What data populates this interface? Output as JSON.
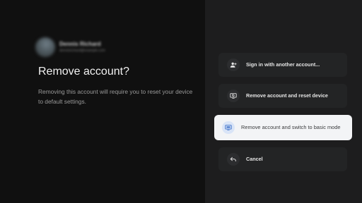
{
  "account": {
    "name": "Dennis Richard",
    "email": "dennisrichard@example.com"
  },
  "dialog": {
    "title": "Remove account?",
    "description": "Removing this account will require you to reset your device to default settings."
  },
  "options": [
    {
      "label": "Sign in with another account...",
      "icon": "person-add-icon",
      "focused": false
    },
    {
      "label": "Remove account and reset device",
      "icon": "reset-device-icon",
      "focused": false
    },
    {
      "label": "Remove account and switch to basic mode",
      "icon": "basic-mode-tv-icon",
      "focused": true
    },
    {
      "label": "Cancel",
      "icon": "back-arrow-icon",
      "focused": false
    }
  ],
  "colors": {
    "background": "#101010",
    "panel": "#1d1d1e",
    "item": "#232425",
    "focused_item": "#f3f4f6",
    "focused_icon_bg": "#d9e4f7",
    "accent": "#3b6fc8"
  }
}
